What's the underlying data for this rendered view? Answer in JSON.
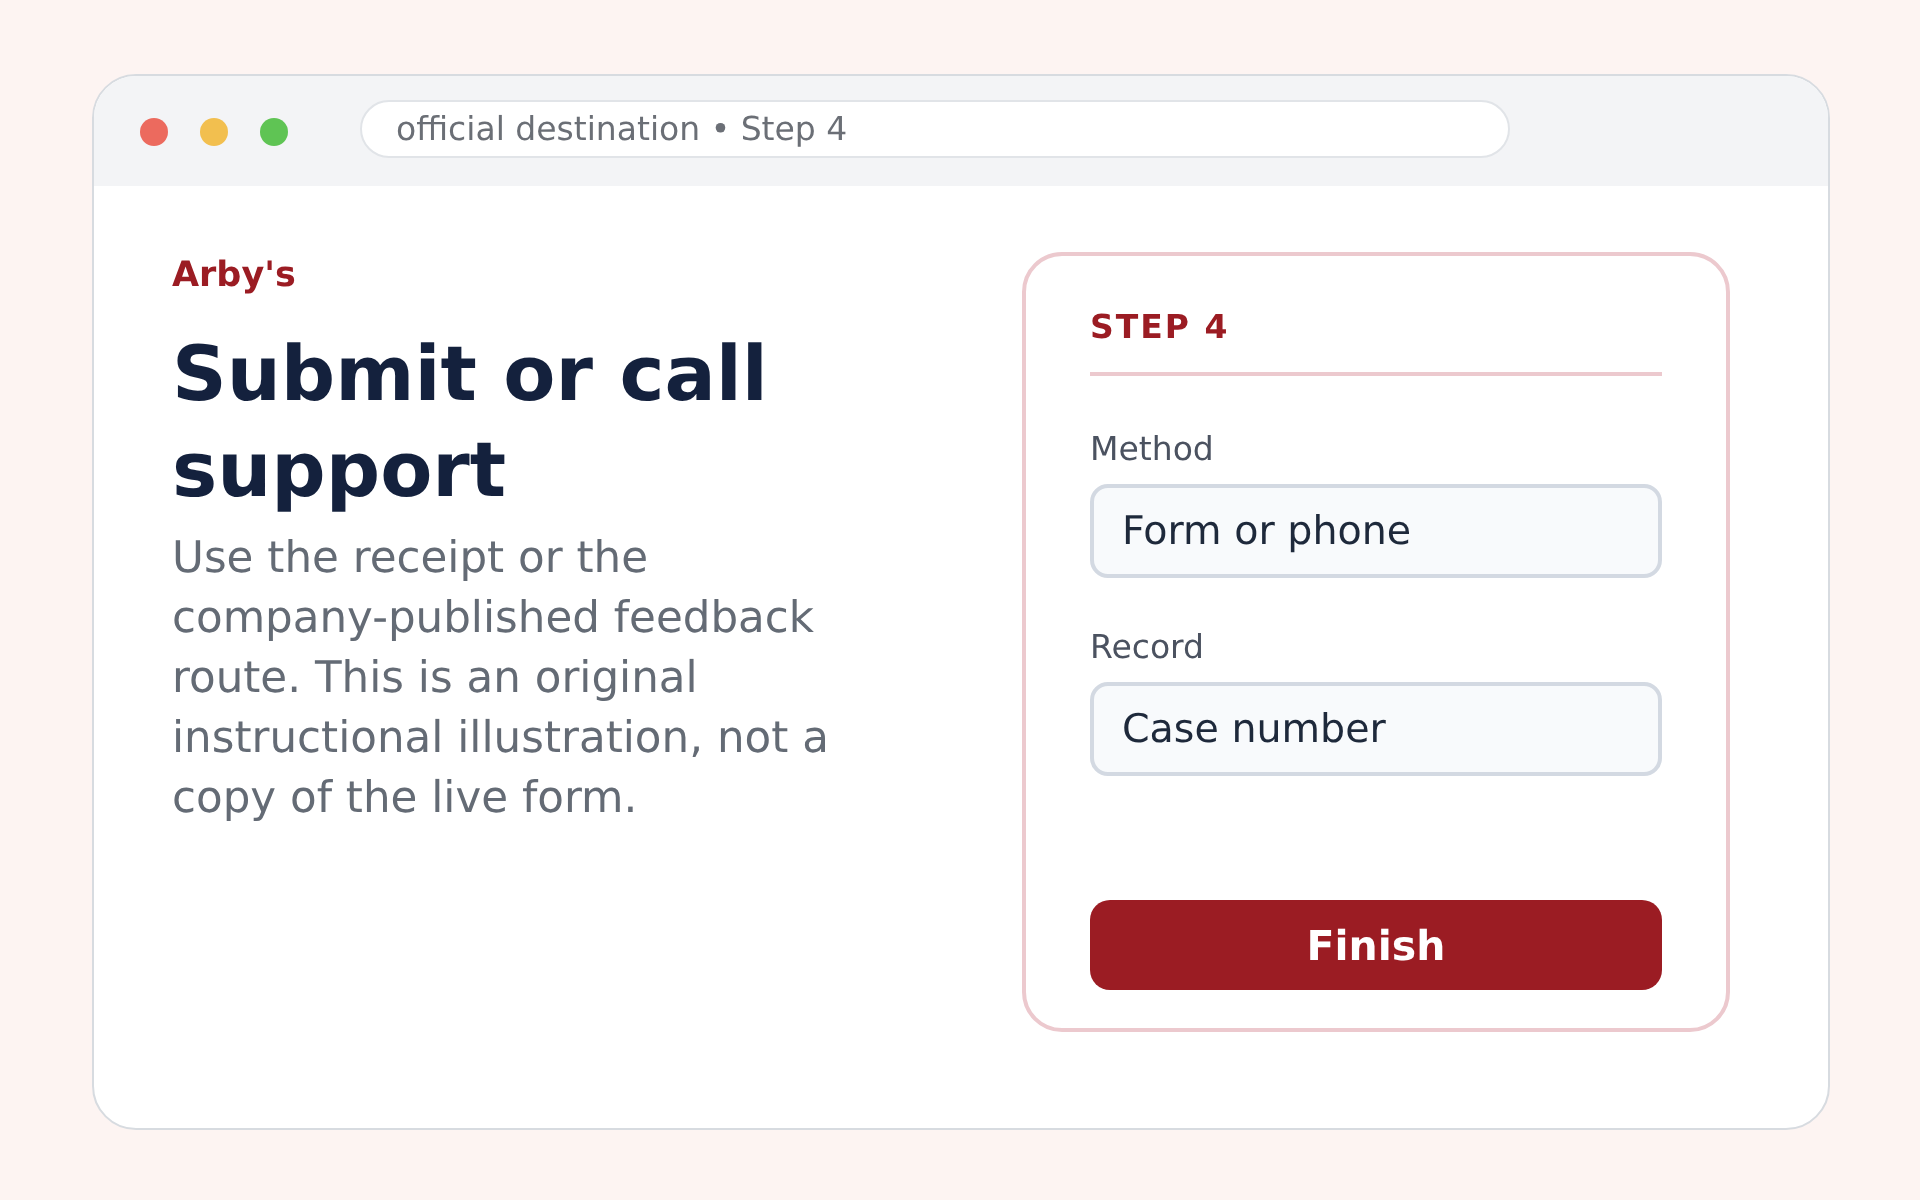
{
  "window": {
    "address": "official destination • Step 4"
  },
  "intro": {
    "brand": "Arby's",
    "heading": "Submit or call support",
    "body": "Use the receipt or the company-published feedback route. This is an original instructional illustration, not a copy of the live form."
  },
  "form": {
    "step": "STEP 4",
    "fields": [
      {
        "label": "Method",
        "value": "Form or phone"
      },
      {
        "label": "Record",
        "value": "Case number"
      }
    ],
    "button": "Finish"
  }
}
